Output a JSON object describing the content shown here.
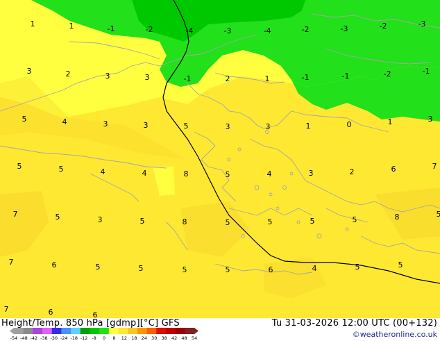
{
  "map": {
    "labels": [
      "1",
      "1",
      "-1",
      "-2",
      "-4",
      "-3",
      "-4",
      "-2",
      "-3",
      "-2",
      "-3",
      "3",
      "2",
      "3",
      "3",
      "-1",
      "2",
      "1",
      "-1",
      "-1",
      "-2",
      "-1",
      "5",
      "4",
      "3",
      "3",
      "5",
      "3",
      "3",
      "1",
      "0",
      "1",
      "3",
      "5",
      "5",
      "4",
      "4",
      "8",
      "5",
      "4",
      "3",
      "2",
      "6",
      "7",
      "7",
      "5",
      "3",
      "5",
      "8",
      "5",
      "5",
      "5",
      "5",
      "8",
      "5",
      "7",
      "6",
      "5",
      "5",
      "5",
      "5",
      "6",
      "4",
      "5",
      "5",
      "7",
      "6",
      "6"
    ],
    "colors": {
      "yellow_light": "#ffff40",
      "yellow": "#ffe832",
      "yellow_orange": "#f5d42a",
      "green_bright": "#22e01a",
      "green": "#00c800",
      "coast": "#a6a6a6",
      "border": "#000000"
    }
  },
  "footer": {
    "title": "Height/Temp. 850 hPa [gdmp][°C] GFS",
    "datetime": "Tu 31-03-2026 12:00 UTC (00+132)",
    "credit": "©weatheronline.co.uk",
    "colorbar_ticks": [
      "-54",
      "-48",
      "-42",
      "-38",
      "-30",
      "-24",
      "-18",
      "-12",
      "-8",
      "0",
      "8",
      "12",
      "18",
      "24",
      "30",
      "38",
      "42",
      "48",
      "54"
    ],
    "colorbar_colors": [
      "#a0a0a0",
      "#8c8c8c",
      "#b040e0",
      "#e060ff",
      "#3030e0",
      "#4890ff",
      "#60d0ff",
      "#00a000",
      "#00c800",
      "#22e01a",
      "#ffff40",
      "#ffe832",
      "#f5c828",
      "#ff9800",
      "#ff6000",
      "#e01000",
      "#c00000",
      "#a00000",
      "#802020"
    ]
  }
}
